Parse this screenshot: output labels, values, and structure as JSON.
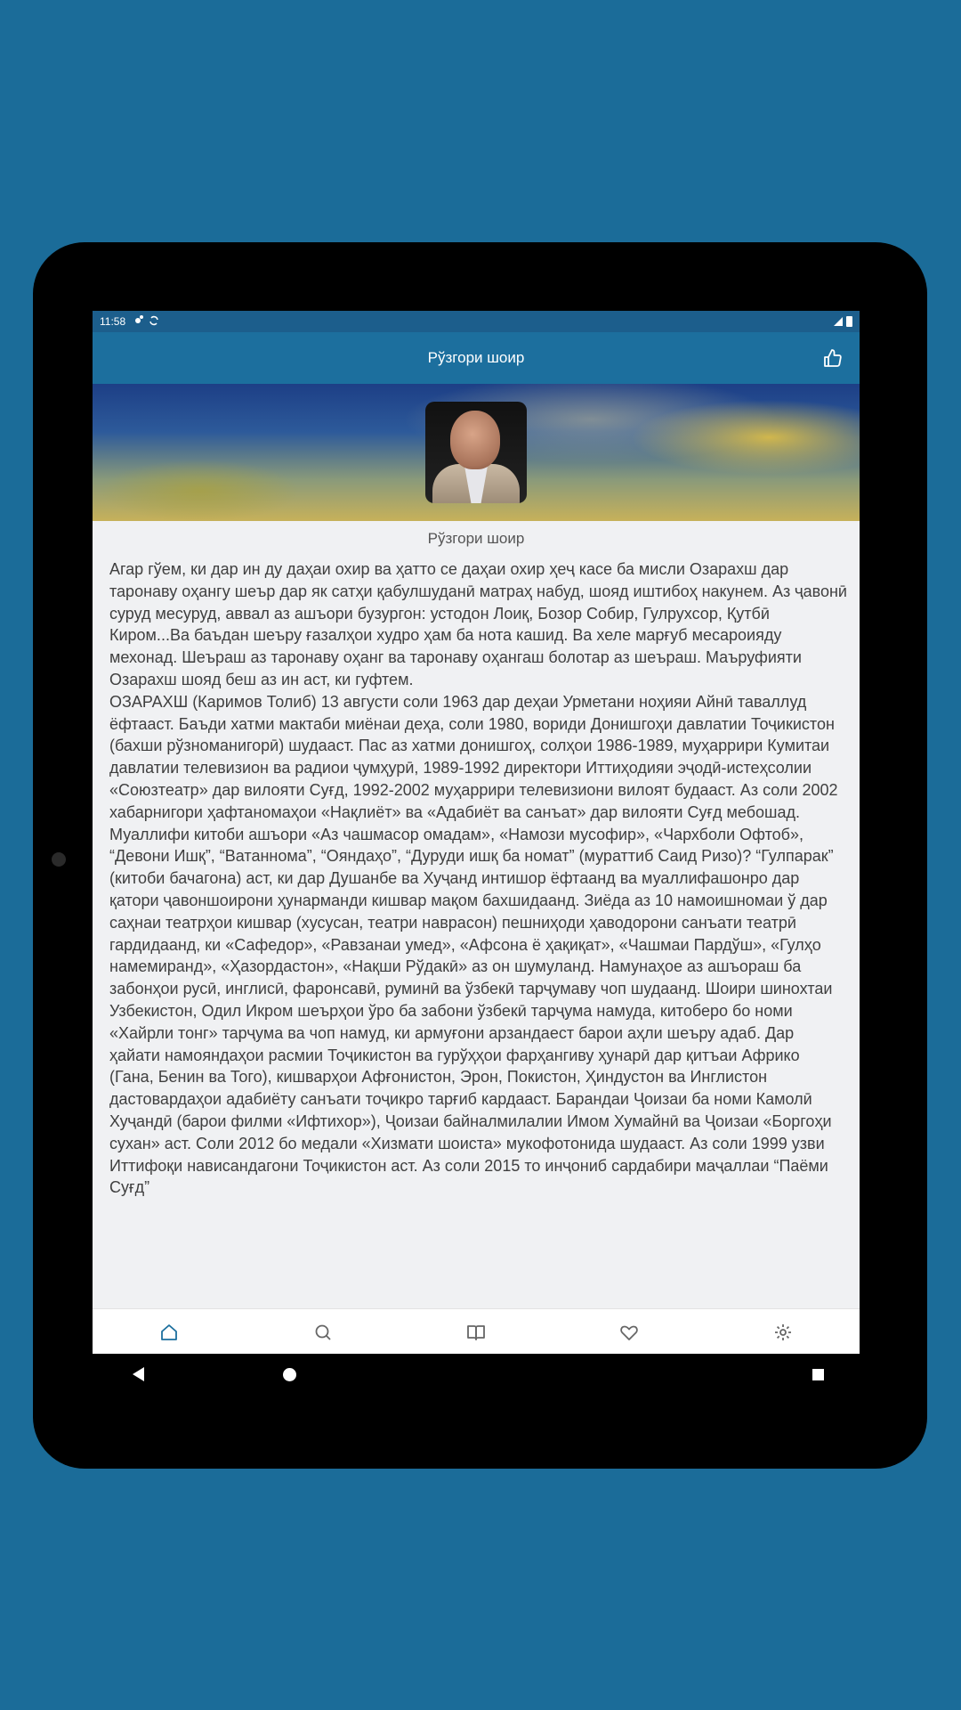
{
  "status_bar": {
    "time": "11:58"
  },
  "app_bar": {
    "title": "Рўзгори шоир"
  },
  "header": {
    "caption": "Рўзгори шоир"
  },
  "bio_text": "   Агар гўем, ки дар ин ду даҳаи охир ва ҳатто се даҳаи охир ҳеҷ касе ба мисли Озарахш дар таронаву оҳангу шеър дар як сатҳи қабулшуданӣ матраҳ набуд, шояд иштибоҳ накунем. Аз ҷавонӣ суруд месуруд, аввал аз ашъори бузургон: устодон Лоиқ, Бозор Собир, Гулрухсор, Қутбӣ Киром...Ва баъдан шеъру ғазалҳои худро ҳам ба нота кашид. Ва хеле марғуб месароияду мехонад. Шеъраш аз таронаву оҳанг ва таронаву оҳангаш болотар аз шеъраш. Маъруфияти Озарахш шояд беш аз ин аст, ки гуфтем.\n   ОЗАРАХШ (Каримов Толиб) 13 августи соли 1963 дар деҳаи Урметани ноҳияи Айнӣ таваллуд ёфтааст. Баъди хатми мактаби миёнаи деҳа, соли 1980, вориди Донишгоҳи давлатии Тоҷикистон (бахши рўзноманигорӣ) шудааст. Пас аз хатми донишгоҳ, солҳои 1986-1989, муҳаррири Кумитаи давлатии телевизион ва радиои ҷумҳурӣ, 1989-1992 директори Иттиҳодияи эҷодӣ-истеҳсолии «Союзтеатр» дар вилояти Суғд, 1992-2002 муҳаррири телевизиони вилоят будааст. Аз соли 2002 хабарнигори ҳафтаномаҳои «Нақлиёт» ва «Адабиёт ва санъат» дар вилояти Суғд мебошад.     Муаллифи китоби ашъори «Аз чашмасор омадам», «Намози мусофир», «Чархболи Офтоб», “Девони Ишқ”, “Ватаннома”, “Ояндаҳо”, “Дуруди ишқ ба номат” (мураттиб Саид Ризо)? “Гулпарак” (китоби бачагона) аст, ки дар Душанбе ва Хуҷанд интишор ёфтаанд ва муаллифашонро дар қатори ҷавоншоирони ҳунарманди кишвар мақом бахшидаанд.     Зиёда аз 10 намоишномаи ў дар саҳнаи театрҳои кишвар (хусусан, театри наврасон) пешниҳоди ҳаводорони санъати театрӣ гардидаанд, ки «Сафедор», «Равзанаи умед», «Афсона ё ҳақиқат», «Чашмаи Пардўш», «Гулҳо намемиранд», «Ҳазордастон», «Нақши Рўдакӣ» аз он шумуланд.     Намунаҳое аз ашъораш ба забонҳои русӣ, инглисӣ, фаронсавӣ, руминӣ ва ўзбекӣ тарҷумаву чоп шудаанд. Шоири шинохтаи Узбекистон, Одил Икром шеърҳои ўро ба забони ўзбекӣ тарҷума намуда, китоберо бо номи «Хайрли тонг» тарҷума ва чоп намуд, ки армуғони арзандаест барои аҳли шеъру адаб.     Дар ҳайати намояндаҳои расмии Тоҷикистон ва гурўҳҳои фарҳангиву ҳунарӣ дар қитъаи Африко (Гана, Бенин ва Того), кишварҳои Афғонистон, Эрон, Покистон, Ҳиндустон ва Инглистон дастовардаҳои адабиёту санъати тоҷикро тарғиб кардааст.     Барандаи Ҷоизаи ба номи Камолӣ Хуҷандӣ (барои филми «Ифтихор»), Ҷоизаи байналмилалии Имом Хумайнӣ ва Ҷоизаи «Боргоҳи сухан» аст.     Соли 2012 бо медали «Хизмати шоиста» мукофотонида шудааст.     Аз соли 1999 узви Иттифоқи нависандагони Тоҷикистон аст.     Аз соли 2015 то инҷониб сардабири маҷаллаи “Паёми Суғд”",
  "nav_items": [
    {
      "name": "home",
      "icon": "home-icon",
      "active": true
    },
    {
      "name": "search",
      "icon": "search-icon",
      "active": false
    },
    {
      "name": "books",
      "icon": "book-icon",
      "active": false
    },
    {
      "name": "favorites",
      "icon": "heart-icon",
      "active": false
    },
    {
      "name": "settings",
      "icon": "gear-icon",
      "active": false
    }
  ],
  "colors": {
    "app_bar": "#1c6f9e",
    "status_bar": "#1c5e8c",
    "background": "#1b6c99",
    "nav_active": "#1c6f9e",
    "nav_inactive": "#666666"
  }
}
